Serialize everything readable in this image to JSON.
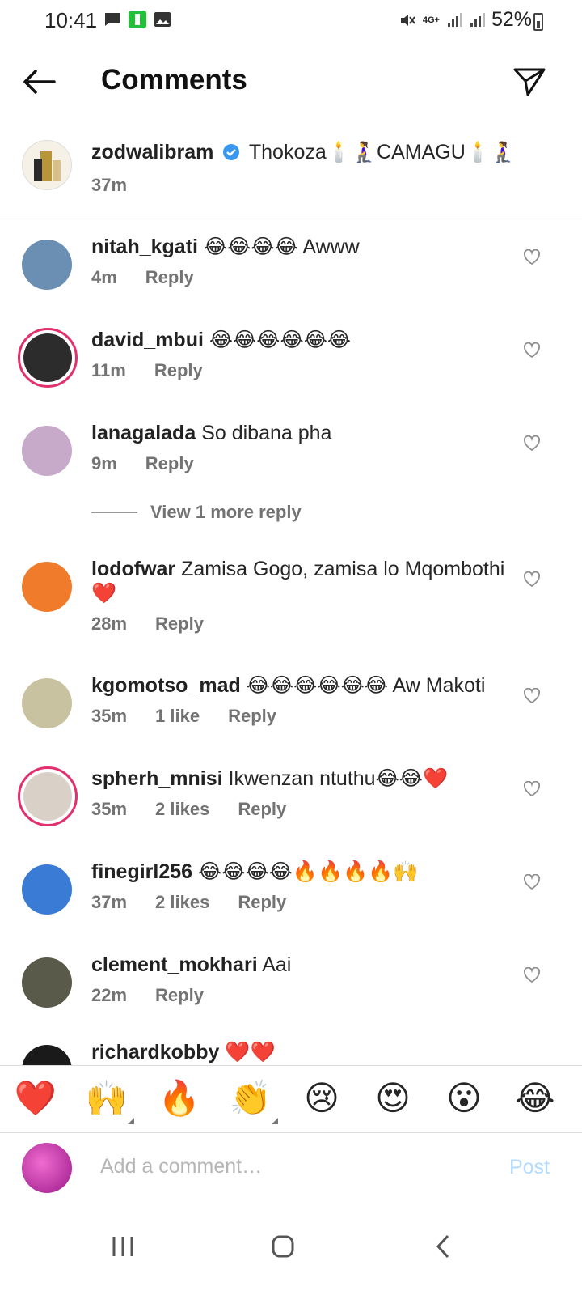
{
  "status_bar": {
    "time": "10:41",
    "network": "4G+",
    "battery": "52%"
  },
  "header": {
    "title": "Comments",
    "back_icon": "arrow-left-icon",
    "send_icon": "paper-plane-icon"
  },
  "caption": {
    "username": "zodwalibram",
    "verified": true,
    "text": "Thokoza🕯️🧎‍♀️CAMAGU🕯️🧎‍♀️",
    "time": "37m"
  },
  "comments": [
    {
      "username": "nitah_kgati",
      "text": "😂😂😂😂 Awww",
      "time": "4m",
      "likes": "",
      "reply": "Reply",
      "ring": false,
      "avatar_color": "#6b8fb3"
    },
    {
      "username": "david_mbui",
      "text": "😂😂😂😂😂😂",
      "time": "11m",
      "likes": "",
      "reply": "Reply",
      "ring": true,
      "avatar_color": "#2c2c2c"
    },
    {
      "username": "lanagalada",
      "text": "So dibana pha",
      "time": "9m",
      "likes": "",
      "reply": "Reply",
      "ring": false,
      "avatar_color": "#c7a9c9"
    },
    {
      "username": "lodofwar",
      "text": "Zamisa Gogo, zamisa lo Mqombothi❤️",
      "time": "28m",
      "likes": "",
      "reply": "Reply",
      "ring": false,
      "avatar_color": "#f07b2a"
    },
    {
      "username": "kgomotso_mad",
      "text": "😂😂😂😂😂😂 Aw Makoti",
      "time": "35m",
      "likes": "1 like",
      "reply": "Reply",
      "ring": false,
      "avatar_color": "#c9c2a0"
    },
    {
      "username": "spherh_mnisi",
      "text": "Ikwenzan ntuthu😂😂❤️",
      "time": "35m",
      "likes": "2 likes",
      "reply": "Reply",
      "ring": true,
      "avatar_color": "#d9d0c8"
    },
    {
      "username": "finegirl256",
      "text": "😂😂😂😂🔥🔥🔥🔥🙌",
      "time": "37m",
      "likes": "2 likes",
      "reply": "Reply",
      "ring": false,
      "avatar_color": "#3a7bd5"
    },
    {
      "username": "clement_mokhari",
      "text": "Aai",
      "time": "22m",
      "likes": "",
      "reply": "Reply",
      "ring": false,
      "avatar_color": "#5a5a4a"
    },
    {
      "username": "richardkobby",
      "text": "❤️❤️",
      "time": "",
      "likes": "",
      "reply": "",
      "ring": false,
      "avatar_color": "#1a1a1a"
    }
  ],
  "view_more": "View 1 more reply",
  "emoji_bar": [
    "❤️",
    "🙌",
    "🔥",
    "👏",
    "😢",
    "😍",
    "😮",
    "😂"
  ],
  "composer": {
    "placeholder": "Add a comment…",
    "post_label": "Post"
  },
  "colors": {
    "ring": "#e1306c",
    "verified": "#3897f0",
    "post_disabled": "#b3dbff"
  }
}
